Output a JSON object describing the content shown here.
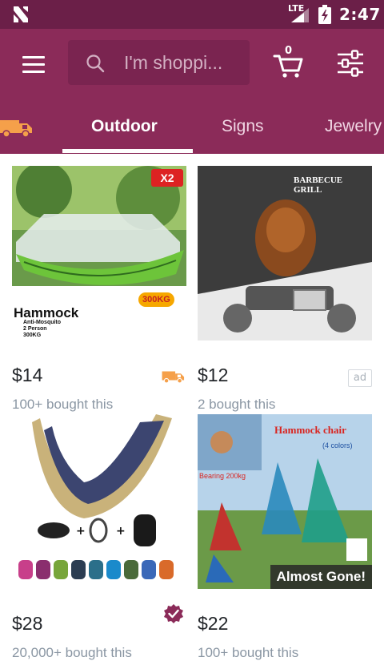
{
  "status": {
    "network": "LTE",
    "time": "2:47"
  },
  "search": {
    "placeholder": "I'm shoppi..."
  },
  "cart": {
    "count": "0"
  },
  "tabs": [
    {
      "label": "Outdoor",
      "active": true
    },
    {
      "label": "Signs",
      "active": false
    },
    {
      "label": "Jewelry",
      "active": false
    }
  ],
  "products": [
    {
      "price": "$14",
      "bought": "100+ bought this",
      "badge": "fast-shipping-truck-icon",
      "image": {
        "corner_tag": "X2",
        "brand_text": "Hammock",
        "features": [
          "Anti-Mosquito",
          "2 Person",
          "300KG"
        ],
        "weight_badge": "300KG"
      }
    },
    {
      "price": "$12",
      "bought": "2 bought this",
      "badge_text": "ad",
      "image": {
        "title": "BARBECUE GRILL"
      }
    },
    {
      "price": "$28",
      "bought": "20,000+ bought this",
      "badge": "verified-check-icon"
    },
    {
      "price": "$22",
      "bought": "100+ bought this",
      "image": {
        "title": "Hammock chair",
        "colors": "(4 colors)",
        "bearing": "Bearing 200kg",
        "overlay": "Almost Gone!"
      }
    }
  ],
  "colors": {
    "status_bar": "#6b1f48",
    "app_bar": "#8b2b59",
    "search_bg": "#7a2450",
    "shipping_orange": "#f5a04a",
    "verified_purple": "#8b2b59"
  }
}
